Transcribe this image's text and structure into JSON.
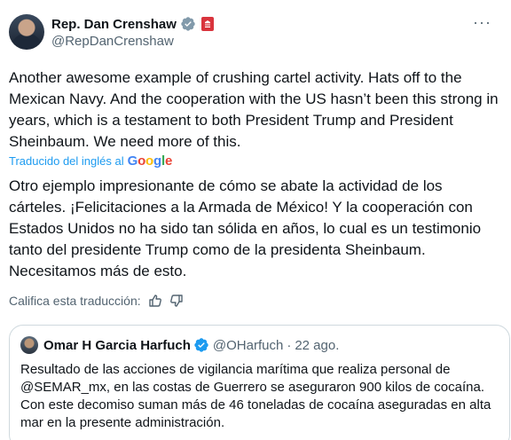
{
  "author": {
    "display_name": "Rep. Dan Crenshaw",
    "handle": "@RepDanCrenshaw"
  },
  "tweet": {
    "text": "Another awesome example of crushing cartel activity. Hats off to the Mexican Navy.  And the cooperation with the US hasn’t been this strong in years, which is a testament to both President Trump and President Sheinbaum. We need more of this."
  },
  "translation": {
    "label": "Traducido del inglés al",
    "provider": "Google",
    "text": "Otro ejemplo impresionante de cómo se abate la actividad de los cárteles. ¡Felicitaciones a la Armada de México! Y la cooperación con Estados Unidos no ha sido tan sólida en años, lo cual es un testimonio tanto del presidente Trump como de la presidenta Sheinbaum. Necesitamos más de esto.",
    "rate_label": "Califica esta traducción:"
  },
  "quote": {
    "display_name": "Omar H Garcia Harfuch",
    "handle": "@OHarfuch",
    "time": "22 ago.",
    "text": "Resultado de las acciones de vigilancia marítima que realiza personal de @SEMAR_mx, en las costas de Guerrero se aseguraron 900 kilos de cocaína. Con este decomiso suman más de 46 toneladas de cocaína aseguradas en alta mar  en la presente administración."
  },
  "icons": {
    "verified": "verified-badge-icon",
    "affiliation": "house-badge-icon",
    "more": "more-options-icon",
    "thumbs_up": "thumbs-up-icon",
    "thumbs_down": "thumbs-down-icon"
  },
  "colors": {
    "verified": "#829aab",
    "quote_verified": "#1d9bf0",
    "link": "#1d9bf0",
    "secondary_text": "#536471",
    "affiliation_badge": "#d9343d"
  }
}
